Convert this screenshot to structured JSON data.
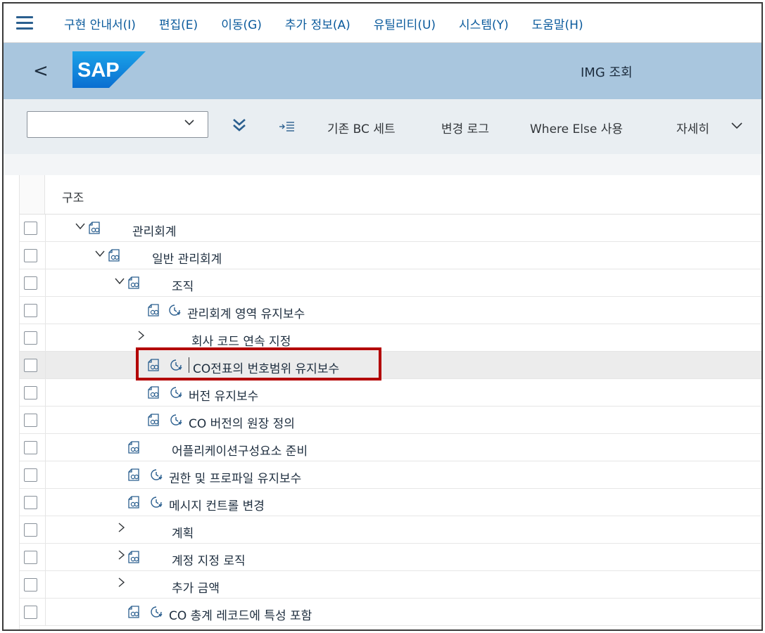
{
  "menubar": {
    "items": [
      "구현 안내서(I)",
      "편집(E)",
      "이동(G)",
      "추가 정보(A)",
      "유틸리티(U)",
      "시스템(Y)",
      "도움말(H)"
    ]
  },
  "titlebar": {
    "back_glyph": "<",
    "logo_text": "SAP",
    "title": "IMG 조회"
  },
  "toolbar": {
    "select_value": "",
    "expand_all_icon": "double-chevron-down-icon",
    "position_icon": "arrow-list-icon",
    "buttons": [
      "기존 BC 세트",
      "변경 로그",
      "Where Else 사용",
      "자세히"
    ]
  },
  "table": {
    "column_header": "구조",
    "rows": [
      {
        "label": "관리회계",
        "expander": "expanded",
        "doc_icon": true,
        "clock_icon": false
      },
      {
        "label": "일반 관리회계",
        "expander": "expanded",
        "doc_icon": true,
        "clock_icon": false
      },
      {
        "label": "조직",
        "expander": "expanded",
        "doc_icon": true,
        "clock_icon": false
      },
      {
        "label": "관리회계 영역 유지보수",
        "expander": "none",
        "doc_icon": true,
        "clock_icon": true
      },
      {
        "label": "회사 코드 연속 지정",
        "expander": "collapsed",
        "doc_icon": false,
        "clock_icon": false
      },
      {
        "label": "CO전표의 번호범위 유지보수",
        "expander": "none",
        "doc_icon": true,
        "clock_icon": true,
        "highlighted": true
      },
      {
        "label": "버전 유지보수",
        "expander": "none",
        "doc_icon": true,
        "clock_icon": true
      },
      {
        "label": "CO 버전의 원장 정의",
        "expander": "none",
        "doc_icon": true,
        "clock_icon": true
      },
      {
        "label": "어플리케이션구성요소 준비",
        "expander": "none",
        "doc_icon": true,
        "clock_icon": false
      },
      {
        "label": "권한 및 프로파일 유지보수",
        "expander": "none",
        "doc_icon": true,
        "clock_icon": true
      },
      {
        "label": "메시지 컨트롤 변경",
        "expander": "none",
        "doc_icon": true,
        "clock_icon": true
      },
      {
        "label": "계획",
        "expander": "collapsed",
        "doc_icon": false,
        "clock_icon": false
      },
      {
        "label": "계정 지정 로직",
        "expander": "collapsed",
        "doc_icon": true,
        "clock_icon": false
      },
      {
        "label": "추가 금액",
        "expander": "collapsed",
        "doc_icon": false,
        "clock_icon": false
      },
      {
        "label": "CO 총계 레코드에 특성 포함",
        "expander": "none",
        "doc_icon": true,
        "clock_icon": true
      }
    ]
  },
  "colors": {
    "menu_text": "#0a5a9c",
    "titlebar_bg": "#a9c6de",
    "toolbar_bg": "#e9eef2",
    "highlight_box": "#b30000",
    "icon_blue": "#2b5f8f"
  }
}
